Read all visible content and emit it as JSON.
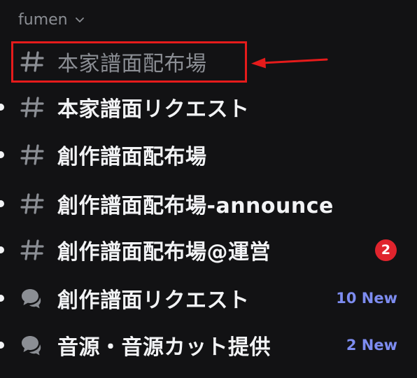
{
  "category": {
    "label": "fumen",
    "icon": "chevron-down-icon"
  },
  "channels": [
    {
      "name": "本家譜面配布場",
      "icon": "hash-icon",
      "unread": false,
      "muted": true,
      "highlighted": true
    },
    {
      "name": "本家譜面リクエスト",
      "icon": "hash-icon",
      "unread": true,
      "muted": false
    },
    {
      "name": "創作譜面配布場",
      "icon": "hash-icon",
      "unread": true,
      "muted": false
    },
    {
      "name": "創作譜面配布場-announce",
      "icon": "hash-icon",
      "unread": true,
      "muted": false
    },
    {
      "name": "創作譜面配布場@運営",
      "icon": "hash-icon",
      "unread": true,
      "muted": false,
      "mentions": "2"
    },
    {
      "name": "創作譜面リクエスト",
      "icon": "forum-icon",
      "unread": true,
      "muted": false,
      "new_label": "10 New"
    },
    {
      "name": "音源・音源カット提供",
      "icon": "forum-icon",
      "unread": true,
      "muted": false,
      "new_label": "2 New"
    }
  ],
  "colors": {
    "background": "#121214",
    "text_primary": "#f2f3f5",
    "text_muted": "#8b8e94",
    "mention_red": "#e0242d",
    "new_blue": "#7d8cf0",
    "annotation_red": "#e51b1b"
  }
}
